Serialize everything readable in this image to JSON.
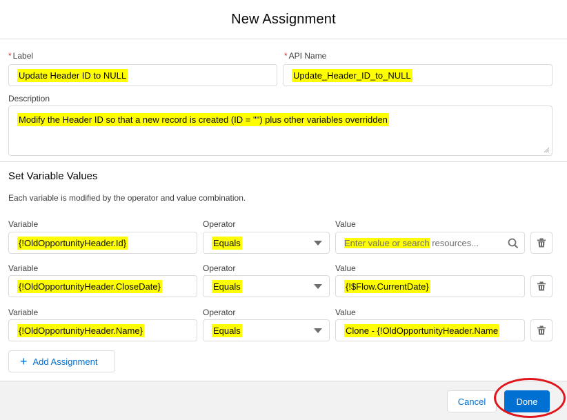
{
  "modal": {
    "title": "New Assignment"
  },
  "label_field": {
    "label": "Label",
    "required_mark": "*",
    "value": "Update Header ID to NULL"
  },
  "api_name_field": {
    "label": "API Name",
    "required_mark": "*",
    "value": "Update_Header_ID_to_NULL"
  },
  "description_field": {
    "label": "Description",
    "value": "Modify the Header ID so that a new record is created (ID = \"\") plus other variables overridden"
  },
  "section": {
    "title": "Set Variable Values",
    "help": "Each variable is modified by the operator and value combination."
  },
  "column_labels": {
    "variable": "Variable",
    "operator": "Operator",
    "value": "Value"
  },
  "assignments": [
    {
      "variable": "{!OldOpportunityHeader.Id}",
      "operator": "Equals",
      "value": "",
      "value_placeholder_highlighted": "Enter value or search",
      "value_placeholder_rest": " resources..."
    },
    {
      "variable": "{!OldOpportunityHeader.CloseDate}",
      "operator": "Equals",
      "value": "{!$Flow.CurrentDate}"
    },
    {
      "variable": "{!OldOpportunityHeader.Name}",
      "operator": "Equals",
      "value": "Clone - {!OldOpportunityHeader.Name"
    }
  ],
  "add_assignment_label": "Add Assignment",
  "footer": {
    "cancel_label": "Cancel",
    "done_label": "Done"
  },
  "colors": {
    "brand": "#0070d2",
    "highlight": "#ffff00",
    "annotation": "#e0161d"
  }
}
